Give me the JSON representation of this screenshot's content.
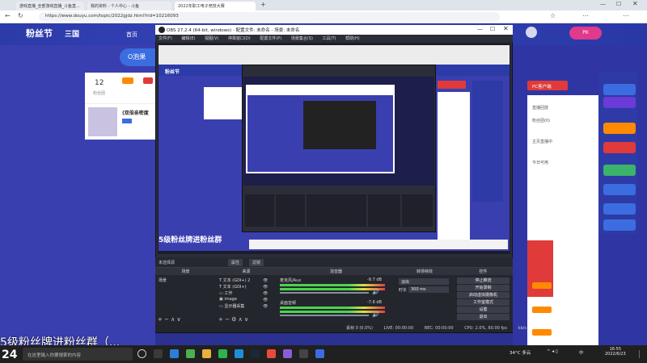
{
  "browser": {
    "tabs": [
      "游戏直播_全部游戏直播_斗鱼直...",
      "我的资料 - 个人中心 - 斗鱼",
      "2022年职工电子竞技大赛"
    ],
    "url": "https://www.douyu.com/topic/2022gjdz.html?rid=10216093"
  },
  "site": {
    "logo": "粉丝节",
    "logo2": "三国",
    "home_label": "首页",
    "room_pill": "O泡果",
    "fans_count": "12",
    "fans_label": "粉丝团",
    "streamer_name": "(双倍亲密度",
    "right_btn": "PC客户端",
    "side_labels": [
      "直播回放",
      "粉丝团(0)",
      "主页直播中",
      "今日可用",
      "最近直播"
    ],
    "blue_badges": [
      "直播间",
      "直播间",
      "直播间",
      "直播间",
      "直播间"
    ]
  },
  "obs": {
    "title": "OBS 27.2.4 (64-bit, windows) - 配置文件: 未命名 - 场景: 未命名",
    "menu": [
      "文件(F)",
      "编辑(E)",
      "视图(V)",
      "停靠窗口(D)",
      "配置文件(P)",
      "场景集合(S)",
      "工具(T)",
      "帮助(H)"
    ],
    "no_source": "未选择源",
    "props_btn": "属性",
    "filters_btn": "滤镜",
    "docks": {
      "scenes": "场景",
      "sources": "来源",
      "mixer": "混音器",
      "transitions": "转场特效",
      "controls": "控件"
    },
    "scene_items": [
      "场景"
    ],
    "source_items": [
      "文本 (GDI+) 2",
      "文本 (GDI+)",
      "工作",
      "image",
      "显示器采集"
    ],
    "mixer_channels": [
      {
        "name": "桌面音频",
        "db": "-7.6 dB"
      },
      {
        "name": "麦克风/Aux",
        "db": "-9.7 dB"
      }
    ],
    "transition_type": "淡出",
    "transition_duration_label": "时长",
    "transition_duration": "300 ms",
    "controls": [
      "停止推流",
      "开始录制",
      "启动虚拟摄像机",
      "工作室模式",
      "设置",
      "退出"
    ],
    "status": {
      "dropped": "丢帧 0 (0.0%)",
      "live": "LIVE: 00:00:00",
      "rec": "REC: 00:00:00",
      "cpu": "CPU: 2.0%, 60.00 fps",
      "kbps": "kb/s"
    }
  },
  "overlay": {
    "caption": "5级粉丝牌进粉丝群",
    "bottom_text": "5级粉丝牌进粉丝群（...",
    "counter": "24"
  },
  "taskbar": {
    "search_placeholder": "在这里输入你要搜索的内容",
    "weather": "34°C 多云",
    "time": "16:55",
    "date": "2022/6/23",
    "lang": "中"
  },
  "colors": {
    "site_bg": "#3a3fb0",
    "obs_bg": "#2b2e38",
    "accent_red": "#e03a3a",
    "accent_orange": "#ff8a00"
  }
}
